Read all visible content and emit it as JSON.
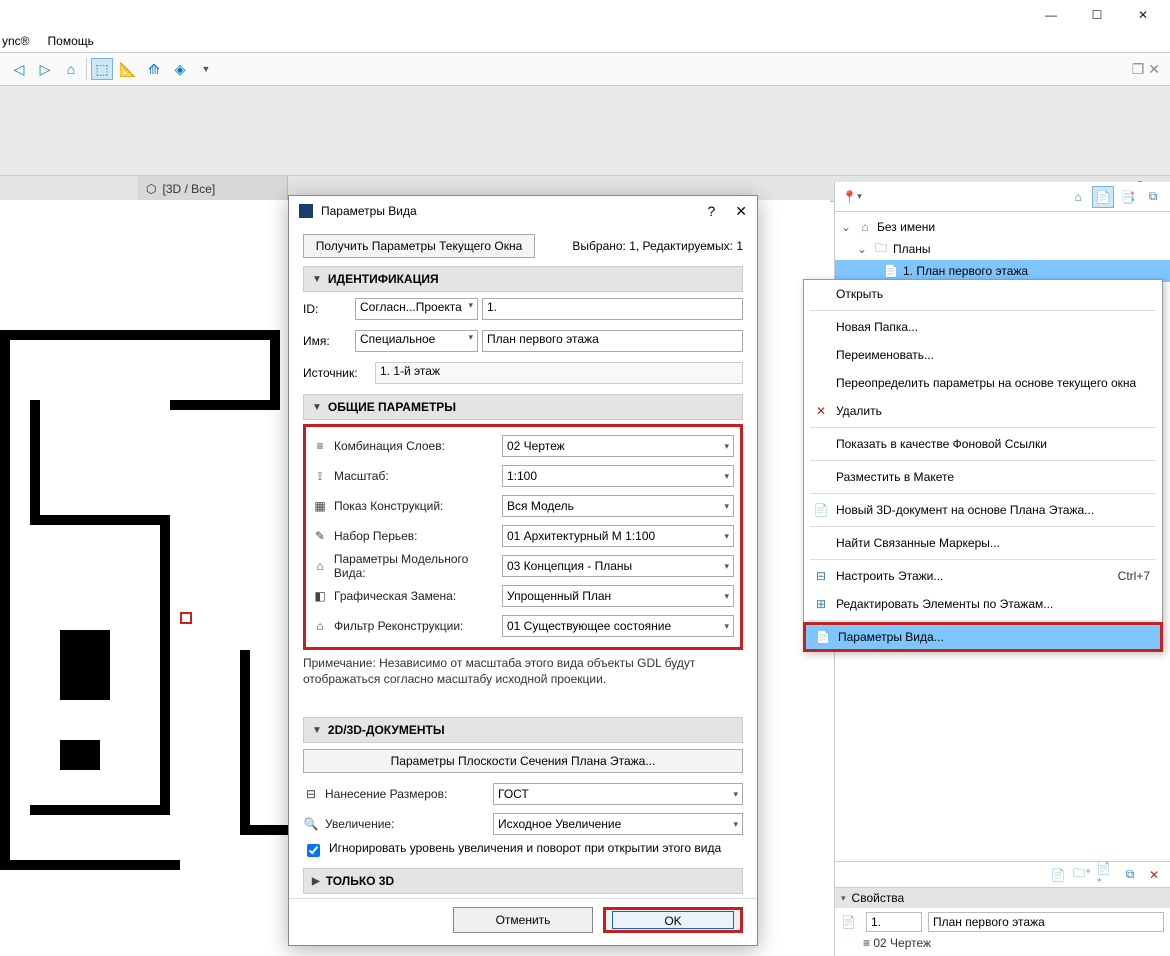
{
  "menubar": {
    "item1": "ync®",
    "item2": "Помощь"
  },
  "tab": {
    "label": "[3D / Все]"
  },
  "dialog": {
    "title": "Параметры Вида",
    "get_btn": "Получить Параметры Текущего Окна",
    "sel_info": "Выбрано: 1, Редактируемых: 1",
    "sect_ident": "ИДЕНТИФИКАЦИЯ",
    "id_lbl": "ID:",
    "id_sel": "Согласн...Проекта",
    "id_val": "1.",
    "name_lbl": "Имя:",
    "name_sel": "Специальное",
    "name_val": "План первого этажа",
    "src_lbl": "Источник:",
    "src_val": "1. 1-й этаж",
    "sect_common": "ОБЩИЕ ПАРАМЕТРЫ",
    "params": {
      "layer_comb": {
        "lbl": "Комбинация Слоев:",
        "val": "02 Чертеж"
      },
      "scale": {
        "lbl": "Масштаб:",
        "val": "1:100"
      },
      "constr": {
        "lbl": "Показ Конструкций:",
        "val": "Вся Модель"
      },
      "pens": {
        "lbl": "Набор Перьев:",
        "val": "01 Архитектурный М 1:100"
      },
      "modelview": {
        "lbl": "Параметры Модельного Вида:",
        "val": "03 Концепция - Планы"
      },
      "override": {
        "lbl": "Графическая Замена:",
        "val": "Упрощенный План"
      },
      "reno": {
        "lbl": "Фильтр Реконструкции:",
        "val": "01 Существующее состояние"
      }
    },
    "note": "Примечание: Независимо от масштаба этого вида объекты GDL будут отображаться согласно масштабу исходной проекции.",
    "sect_2d3d": "2D/3D-ДОКУМЕНТЫ",
    "cutplane_btn": "Параметры Плоскости Сечения Плана Этажа...",
    "dim_lbl": "Нанесение Размеров:",
    "dim_val": "ГОСТ",
    "zoom_lbl": "Увеличение:",
    "zoom_val": "Исходное Увеличение",
    "chk_lbl": "Игнорировать уровень увеличения и поворот при открытии этого вида",
    "sect_3d": "ТОЛЬКО 3D",
    "cancel": "Отменить",
    "ok": "OK"
  },
  "tree": {
    "root": "Без имени",
    "folder": "Планы",
    "item": "1. План первого этажа"
  },
  "ctx": {
    "open": "Открыть",
    "newfolder": "Новая Папка...",
    "rename": "Переименовать...",
    "override": "Переопределить параметры на основе текущего окна",
    "delete": "Удалить",
    "showref": "Показать в качестве Фоновой Ссылки",
    "place": "Разместить в Макете",
    "new3d": "Новый 3D-документ на основе Плана Этажа...",
    "findmarkers": "Найти Связанные Маркеры...",
    "stories": "Настроить Этажи...",
    "stories_kb": "Ctrl+7",
    "editstories": "Редактировать Элементы по Этажам...",
    "viewparams": "Параметры Вида..."
  },
  "props": {
    "header": "Свойства",
    "id": "1.",
    "name": "План первого этажа",
    "layer": "02 Чертеж"
  }
}
